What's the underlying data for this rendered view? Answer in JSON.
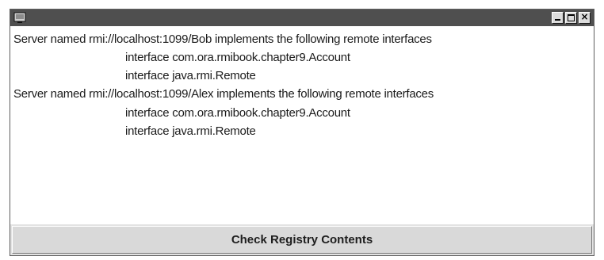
{
  "window": {
    "title": "",
    "controls": {
      "minimize_icon": "minimize-icon",
      "maximize_icon": "maximize-icon",
      "close_icon": "close-icon",
      "close_glyph": "×"
    }
  },
  "output": {
    "lines": [
      "Server named rmi://localhost:1099/Bob implements the following remote interfaces",
      "interface com.ora.rmibook.chapter9.Account",
      "interface java.rmi.Remote",
      "Server named rmi://localhost:1099/Alex implements the following remote interfaces",
      "interface com.ora.rmibook.chapter9.Account",
      "interface java.rmi.Remote"
    ]
  },
  "button": {
    "label": "Check Registry Contents"
  }
}
